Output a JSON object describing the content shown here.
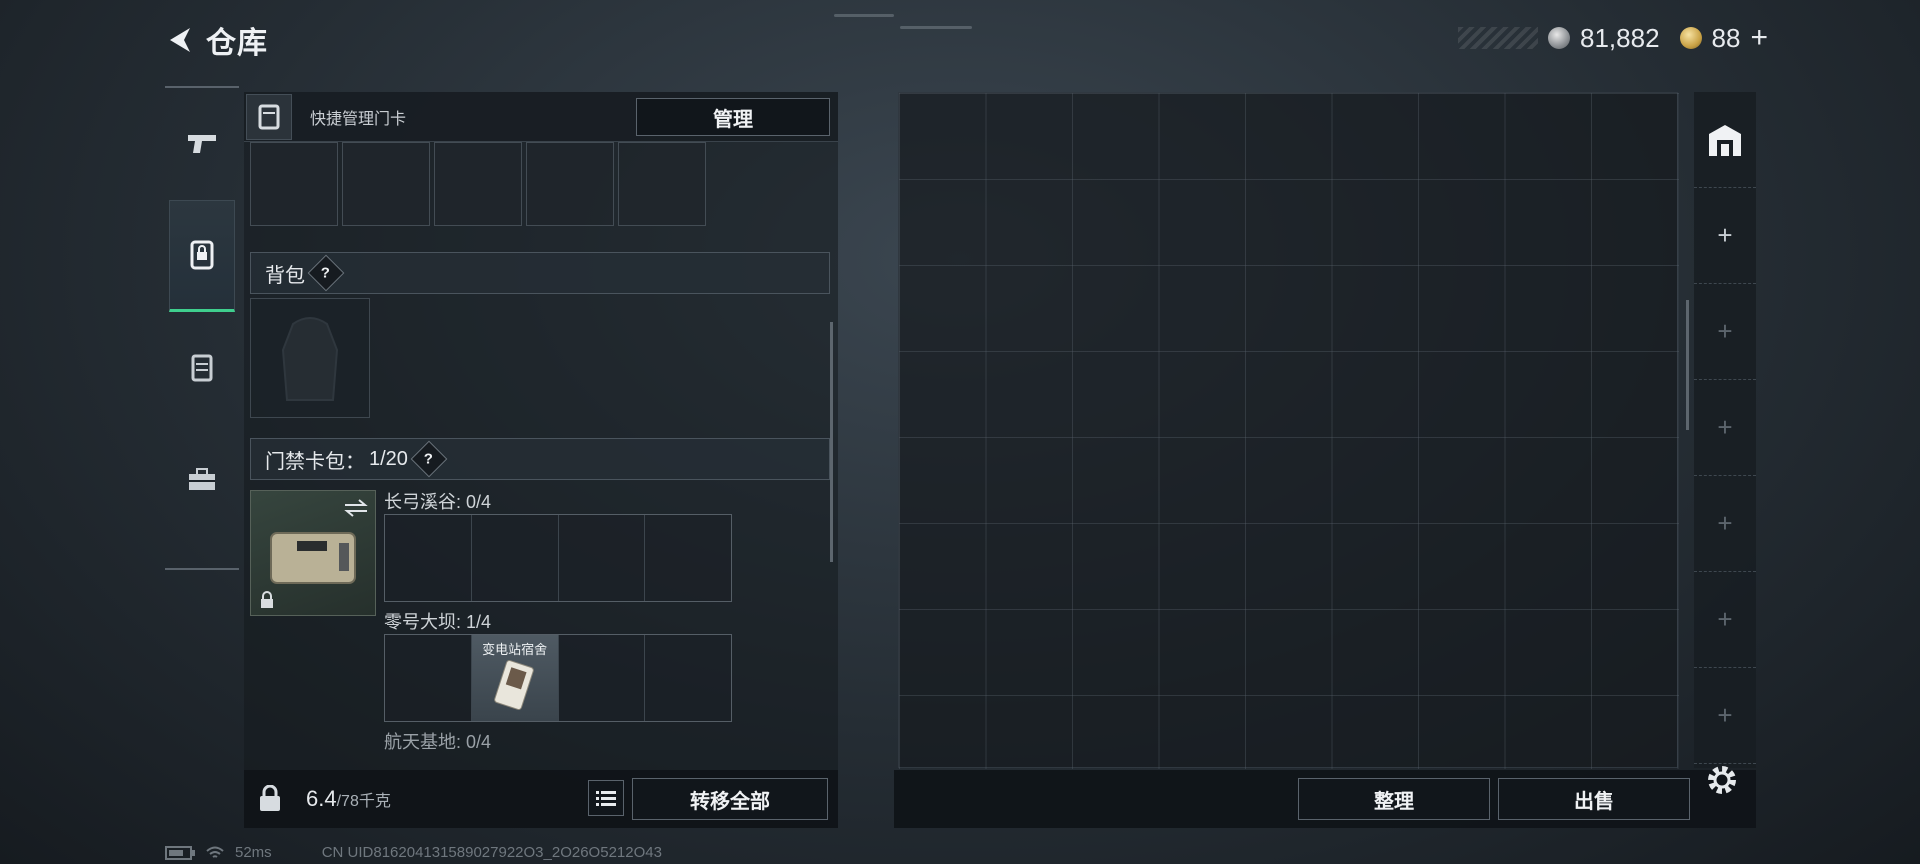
{
  "header": {
    "title": "仓库",
    "back_icon": "chevron-left-icon"
  },
  "currency": {
    "silver_amount": "81,882",
    "gold_amount": "88",
    "plus_label": "+"
  },
  "rail": {
    "items": [
      {
        "icon": "pistol-icon"
      },
      {
        "icon": "backpack-lock-icon",
        "active": true
      },
      {
        "icon": "vest-icon"
      },
      {
        "icon": "toolbox-icon"
      }
    ]
  },
  "inventory": {
    "header_label": "快捷管理门卡",
    "manage_button": "管理",
    "backpack_section": "背包",
    "keycard_section_label": "门禁卡包：",
    "keycard_section_count": "1/20",
    "help_mark": "?",
    "maps": [
      {
        "label": "长弓溪谷: 0/4",
        "cards": [
          "",
          "",
          "",
          ""
        ]
      },
      {
        "label": "零号大坝: 1/4",
        "cards": [
          "",
          "变电站宿舍",
          "",
          ""
        ]
      },
      {
        "label": "航天基地: 0/4",
        "cards": []
      }
    ],
    "weight_value": "6.4",
    "weight_capacity": "/78千克",
    "transfer_all_button": "转移全部"
  },
  "storage": {
    "sort_button": "整理",
    "sell_button": "出售",
    "tabs": [
      "home-tab",
      "+",
      "+",
      "+",
      "+",
      "+",
      "+"
    ]
  },
  "status_bar": {
    "latency": "52ms",
    "uid": "CN UID816204131589027922O3_2O26O5212O43"
  },
  "colors": {
    "accent_green": "#3fcf8e",
    "panel_dark": "#11161b"
  }
}
